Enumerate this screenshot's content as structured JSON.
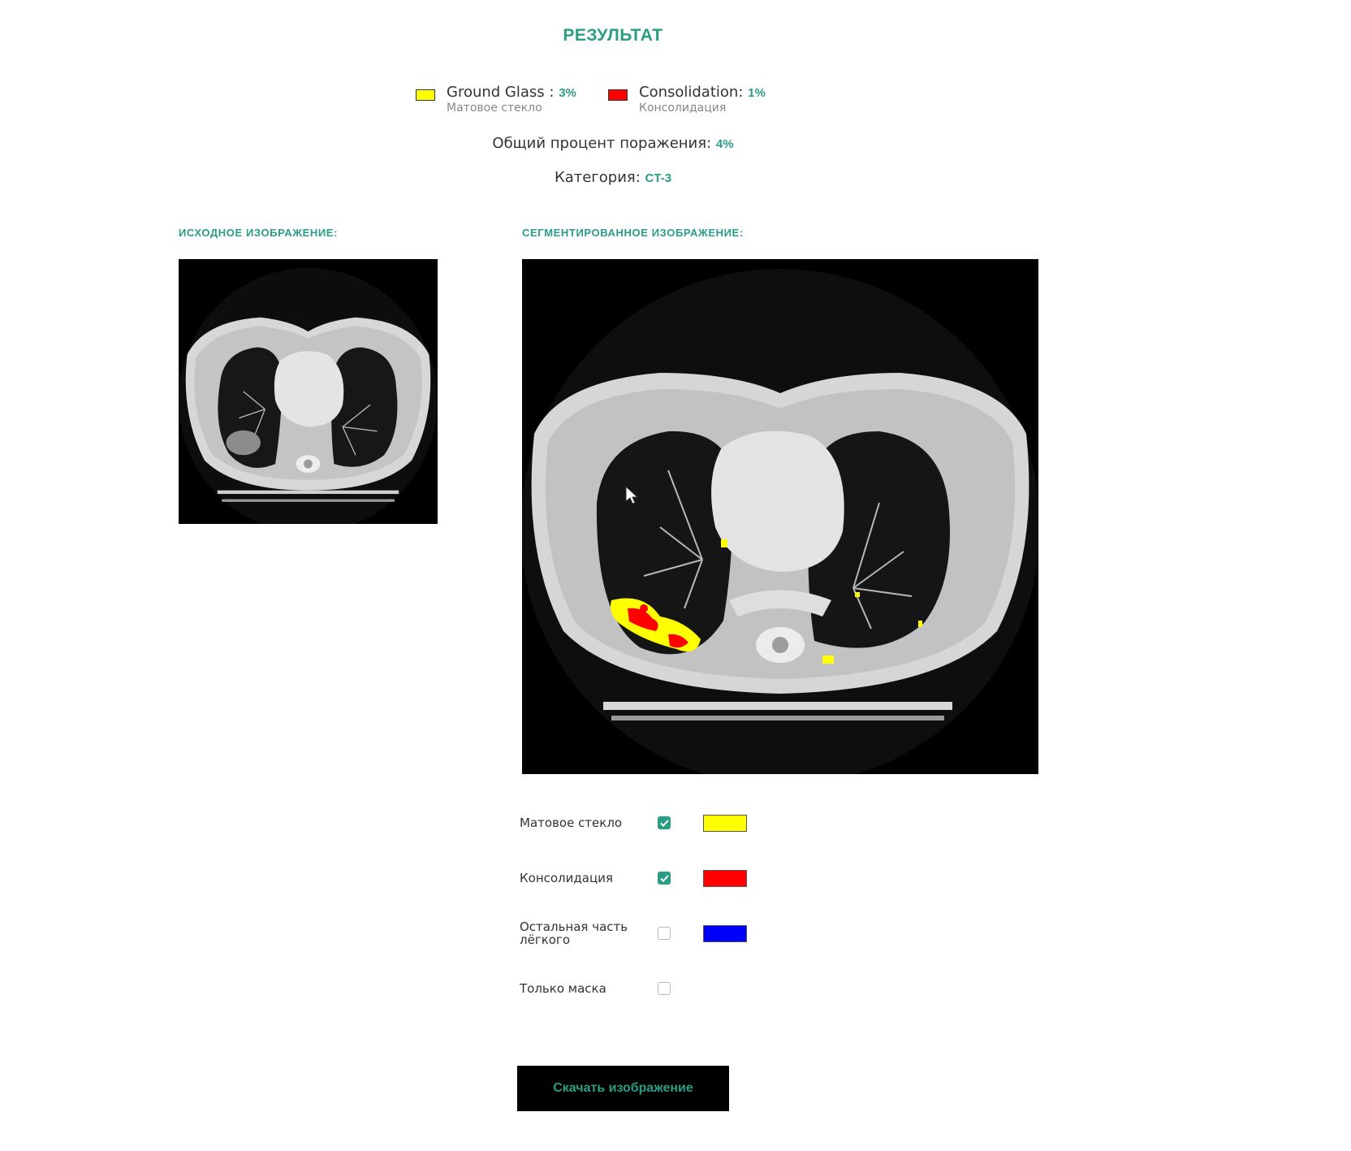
{
  "title": "РЕЗУЛЬТАТ",
  "legend": [
    {
      "name_en": "Ground Glass :",
      "pct": "3%",
      "name_ru": "Матовое стекло",
      "color": "#ffff00"
    },
    {
      "name_en": "Consolidation:",
      "pct": "1%",
      "name_ru": "Консолидация",
      "color": "#ff0000"
    }
  ],
  "summary": {
    "total_label": "Общий процент поражения:",
    "total_value": "4%",
    "category_label": "Категория:",
    "category_value": "CT-3"
  },
  "sections": {
    "original_label": "ИСХОДНОЕ ИЗОБРАЖЕНИЕ:",
    "segmented_label": "СЕГМЕНТИРОВАННОЕ ИЗОБРАЖЕНИЕ:"
  },
  "controls": [
    {
      "label": "Матовое стекло",
      "checked": true,
      "color": "#ffff00"
    },
    {
      "label": "Консолидация",
      "checked": true,
      "color": "#ff0000"
    },
    {
      "label": "Остальная часть лёгкого",
      "checked": false,
      "color": "#0000ff"
    },
    {
      "label": "Только маска",
      "checked": false,
      "color": null
    }
  ],
  "download_label": "Скачать изображение",
  "icons": {
    "checkmark": "checkmark-icon",
    "cursor": "pointer-cursor-icon"
  }
}
